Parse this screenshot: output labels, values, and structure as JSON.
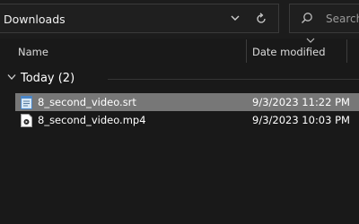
{
  "address_bar": {
    "location": "Downloads"
  },
  "search": {
    "placeholder": "Search"
  },
  "columns": {
    "name": "Name",
    "date_modified": "Date modified"
  },
  "group": {
    "label": "Today (2)"
  },
  "files": [
    {
      "name": "8_second_video.srt",
      "date": "9/3/2023 11:22 PM",
      "icon": "text-file-icon",
      "selected": true
    },
    {
      "name": "8_second_video.mp4",
      "date": "9/3/2023 10:03 PM",
      "icon": "video-file-icon",
      "selected": false
    }
  ],
  "colors": {
    "background": "#191919",
    "selection": "#777777",
    "text": "#ffffff"
  }
}
